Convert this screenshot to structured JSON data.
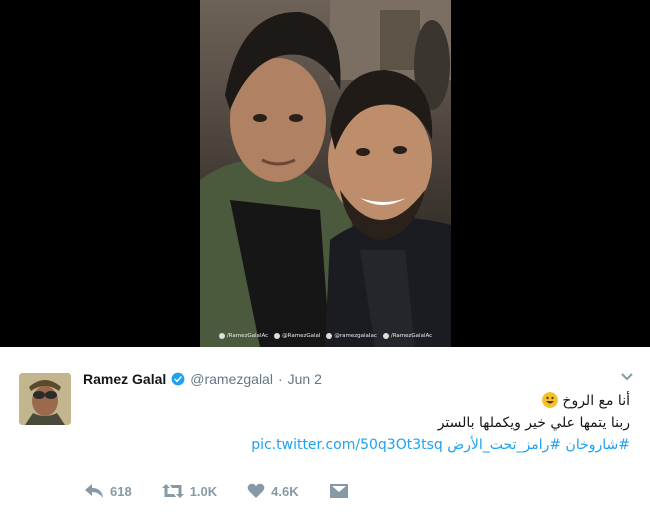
{
  "media": {
    "watermark": [
      "/RamezGalalAc",
      "@RamezGalal",
      "@ramezgalalac",
      "/RamezGalalAc"
    ]
  },
  "tweet": {
    "name": "Ramez Galal",
    "handle": "@ramezgalal",
    "separator": "·",
    "date": "Jun 2",
    "line1": "أنا مع الروخ",
    "line2": "ربنا يتمها علي خير ويكملها بالستر",
    "hashtag1": "#شاروخان",
    "hashtag2": "#رامز_تحت_الأرض",
    "link": "pic.twitter.com/50q3Ot3tsq"
  },
  "actions": {
    "replies": "618",
    "retweets": "1.0K",
    "likes": "4.6K"
  },
  "colors": {
    "accent": "#1da1f2",
    "muted": "#8899a6"
  },
  "icons": [
    "verified-icon",
    "chevron-down-icon",
    "reply-icon",
    "retweet-icon",
    "like-icon",
    "dm-icon",
    "smile-emoji"
  ]
}
